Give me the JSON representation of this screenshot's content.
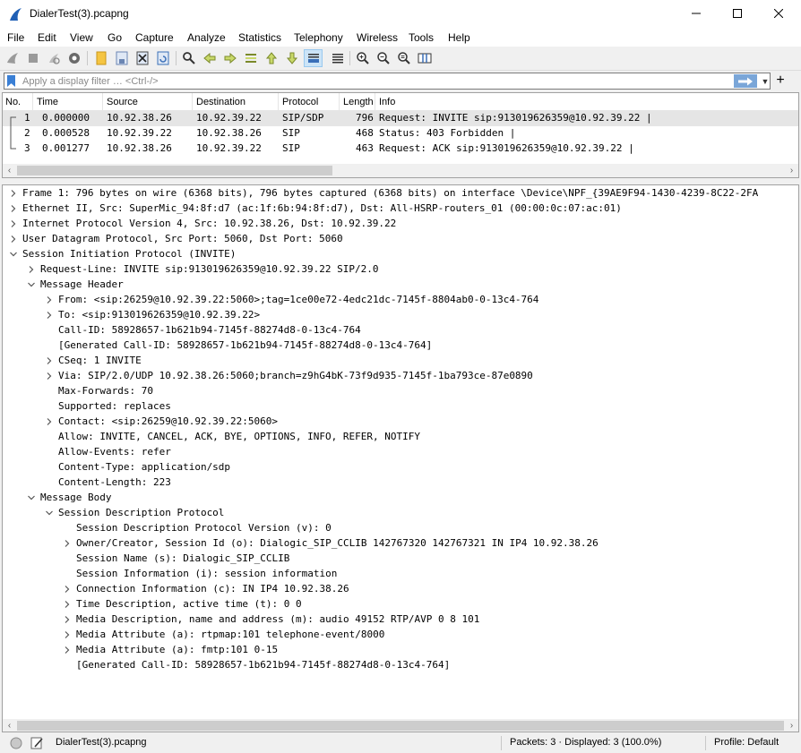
{
  "window": {
    "title": "DialerTest(3).pcapng",
    "brand_color": "#1f5fb5"
  },
  "menu": [
    "File",
    "Edit",
    "View",
    "Go",
    "Capture",
    "Analyze",
    "Statistics",
    "Telephony",
    "Wireless",
    "Tools",
    "Help"
  ],
  "toolbar": {
    "icons": [
      "start-capture-icon",
      "stop-capture-icon",
      "restart-capture-icon",
      "capture-options-icon",
      "open-file-icon",
      "save-file-icon",
      "close-file-icon",
      "reload-file-icon",
      "find-packet-icon",
      "go-back-icon",
      "go-forward-icon",
      "go-to-packet-icon",
      "first-packet-icon",
      "last-packet-icon",
      "auto-scroll-icon",
      "colorize-icon",
      "zoom-in-icon",
      "zoom-out-icon",
      "normal-size-icon",
      "resize-columns-icon"
    ]
  },
  "filter": {
    "placeholder": "Apply a display filter … <Ctrl-/>",
    "value": "",
    "plus": "+"
  },
  "packet_list": {
    "columns": [
      "No.",
      "Time",
      "Source",
      "Destination",
      "Protocol",
      "Length",
      "Info"
    ],
    "rows": [
      {
        "no": "1",
        "time": "0.000000",
        "source": "10.92.38.26",
        "destination": "10.92.39.22",
        "protocol": "SIP/SDP",
        "length": "796",
        "info": "Request: INVITE sip:913019626359@10.92.39.22 |"
      },
      {
        "no": "2",
        "time": "0.000528",
        "source": "10.92.39.22",
        "destination": "10.92.38.26",
        "protocol": "SIP",
        "length": "468",
        "info": "Status: 403 Forbidden |"
      },
      {
        "no": "3",
        "time": "0.001277",
        "source": "10.92.38.26",
        "destination": "10.92.39.22",
        "protocol": "SIP",
        "length": "463",
        "info": "Request: ACK sip:913019626359@10.92.39.22 |"
      }
    ],
    "selected_row": 0
  },
  "details": [
    {
      "text": "Frame 1: 796 bytes on wire (6368 bits), 796 bytes captured (6368 bits) on interface \\Device\\NPF_{39AE9F94-1430-4239-8C22-2FA",
      "expander": "collapsed",
      "level": 0
    },
    {
      "text": "Ethernet II, Src: SuperMic_94:8f:d7 (ac:1f:6b:94:8f:d7), Dst: All-HSRP-routers_01 (00:00:0c:07:ac:01)",
      "expander": "collapsed",
      "level": 0
    },
    {
      "text": "Internet Protocol Version 4, Src: 10.92.38.26, Dst: 10.92.39.22",
      "expander": "collapsed",
      "level": 0
    },
    {
      "text": "User Datagram Protocol, Src Port: 5060, Dst Port: 5060",
      "expander": "collapsed",
      "level": 0
    },
    {
      "text": "Session Initiation Protocol (INVITE)",
      "expander": "expanded",
      "level": 0
    },
    {
      "text": "Request-Line: INVITE sip:913019626359@10.92.39.22 SIP/2.0",
      "expander": "collapsed",
      "level": 1
    },
    {
      "text": "Message Header",
      "expander": "expanded",
      "level": 1
    },
    {
      "text": "From: <sip:26259@10.92.39.22:5060>;tag=1ce00e72-4edc21dc-7145f-8804ab0-0-13c4-764",
      "expander": "collapsed",
      "level": 2
    },
    {
      "text": "To: <sip:913019626359@10.92.39.22>",
      "expander": "collapsed",
      "level": 2
    },
    {
      "text": "Call-ID: 58928657-1b621b94-7145f-88274d8-0-13c4-764",
      "expander": "none",
      "level": 2
    },
    {
      "text": "[Generated Call-ID: 58928657-1b621b94-7145f-88274d8-0-13c4-764]",
      "expander": "none",
      "level": 2
    },
    {
      "text": "CSeq: 1 INVITE",
      "expander": "collapsed",
      "level": 2
    },
    {
      "text": "Via: SIP/2.0/UDP 10.92.38.26:5060;branch=z9hG4bK-73f9d935-7145f-1ba793ce-87e0890",
      "expander": "collapsed",
      "level": 2
    },
    {
      "text": "Max-Forwards: 70",
      "expander": "none",
      "level": 2
    },
    {
      "text": "Supported: replaces",
      "expander": "none",
      "level": 2
    },
    {
      "text": "Contact: <sip:26259@10.92.39.22:5060>",
      "expander": "collapsed",
      "level": 2
    },
    {
      "text": "Allow: INVITE, CANCEL, ACK, BYE, OPTIONS, INFO, REFER, NOTIFY",
      "expander": "none",
      "level": 2
    },
    {
      "text": "Allow-Events: refer",
      "expander": "none",
      "level": 2
    },
    {
      "text": "Content-Type: application/sdp",
      "expander": "none",
      "level": 2
    },
    {
      "text": "Content-Length: 223",
      "expander": "none",
      "level": 2
    },
    {
      "text": "Message Body",
      "expander": "expanded",
      "level": 1
    },
    {
      "text": "Session Description Protocol",
      "expander": "expanded",
      "level": 2
    },
    {
      "text": "Session Description Protocol Version (v): 0",
      "expander": "none",
      "level": 3
    },
    {
      "text": "Owner/Creator, Session Id (o): Dialogic_SIP_CCLIB 142767320 142767321 IN IP4 10.92.38.26",
      "expander": "collapsed",
      "level": 3
    },
    {
      "text": "Session Name (s): Dialogic_SIP_CCLIB",
      "expander": "none",
      "level": 3
    },
    {
      "text": "Session Information (i): session information",
      "expander": "none",
      "level": 3
    },
    {
      "text": "Connection Information (c): IN IP4 10.92.38.26",
      "expander": "collapsed",
      "level": 3
    },
    {
      "text": "Time Description, active time (t): 0 0",
      "expander": "collapsed",
      "level": 3
    },
    {
      "text": "Media Description, name and address (m): audio 49152 RTP/AVP 0 8 101",
      "expander": "collapsed",
      "level": 3
    },
    {
      "text": "Media Attribute (a): rtpmap:101 telephone-event/8000",
      "expander": "collapsed",
      "level": 3
    },
    {
      "text": "Media Attribute (a): fmtp:101 0-15",
      "expander": "collapsed",
      "level": 3
    },
    {
      "text": "[Generated Call-ID: 58928657-1b621b94-7145f-88274d8-0-13c4-764]",
      "expander": "none",
      "level": 3
    }
  ],
  "status": {
    "file": "DialerTest(3).pcapng",
    "packets": "Packets: 3 · Displayed: 3 (100.0%)",
    "profile": "Profile: Default"
  }
}
